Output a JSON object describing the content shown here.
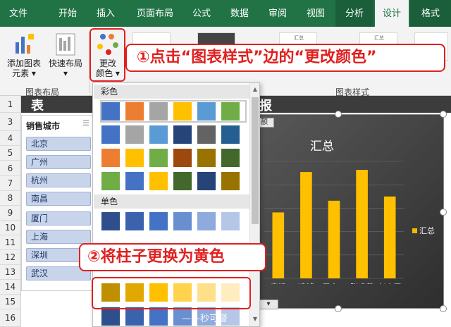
{
  "tabs": [
    "文件",
    "开始",
    "插入",
    "页面布局",
    "公式",
    "数据",
    "审阅",
    "视图",
    "分析",
    "设计",
    "格式"
  ],
  "ribbon": {
    "add_chart_element": "添加图表\n元素",
    "add_chart_element_l1": "添加图表",
    "add_chart_element_l2": "元素 ▾",
    "quick_layout_l1": "快速布局",
    "quick_layout_l2": "▾",
    "change_colors_l1": "更改",
    "change_colors_l2": "颜色 ▾",
    "group_chart_layout": "图表布局",
    "group_chart_styles": "图表样式",
    "thumb_title": "汇总"
  },
  "annotations": {
    "step1": "①点击“图表样式”边的“更改颜色”",
    "step2": "②将柱子更换为黄色"
  },
  "row_numbers": [
    "1",
    "3",
    "4",
    "5",
    "6",
    "7",
    "8",
    "9",
    "10",
    "11",
    "12",
    "13",
    "14",
    "15",
    "16"
  ],
  "title_bar": {
    "left_char": "表",
    "right_char": "报"
  },
  "slicer": {
    "title": "销售城市",
    "items": [
      "北京",
      "广州",
      "杭州",
      "南昌",
      "厦门",
      "上海",
      "深圳",
      "武汉"
    ]
  },
  "dropdown": {
    "section_colorful": "彩色",
    "section_mono": "单色",
    "colors": {
      "row1": [
        "#4472c4",
        "#ed7d31",
        "#a5a5a5",
        "#ffc000",
        "#5b9bd5",
        "#70ad47"
      ],
      "row2": [
        "#4472c4",
        "#a5a5a5",
        "#5b9bd5",
        "#264478",
        "#636363",
        "#255e91"
      ],
      "row3": [
        "#ed7d31",
        "#ffc000",
        "#70ad47",
        "#9e480e",
        "#997300",
        "#43682b"
      ],
      "row4": [
        "#70ad47",
        "#4472c4",
        "#ffc000",
        "#43682b",
        "#264478",
        "#997300"
      ],
      "mono1": [
        "#2e4f8c",
        "#3a62ad",
        "#4472c4",
        "#6a8fd0",
        "#8faadc",
        "#b4c7e7"
      ],
      "mono_yellow": [
        "#bf8f00",
        "#e0a800",
        "#ffc000",
        "#ffd34d",
        "#ffe08a",
        "#ffecbf"
      ]
    }
  },
  "chart": {
    "field_button": "额",
    "title": "汇总",
    "legend": "汇总",
    "bar_color": "#ffc000"
  },
  "chart_data": {
    "type": "bar",
    "title": "汇总",
    "categories": [
      "表姐",
      "凌祯",
      "王大刀",
      "张盛茗",
      "赵小平"
    ],
    "values": [
      62,
      100,
      73,
      102,
      77
    ],
    "ylim": [
      0,
      110
    ],
    "legend": "right",
    "series": [
      {
        "name": "汇总",
        "values": [
          62,
          100,
          73,
          102,
          77
        ]
      }
    ]
  },
  "watermark": "——秒可督"
}
